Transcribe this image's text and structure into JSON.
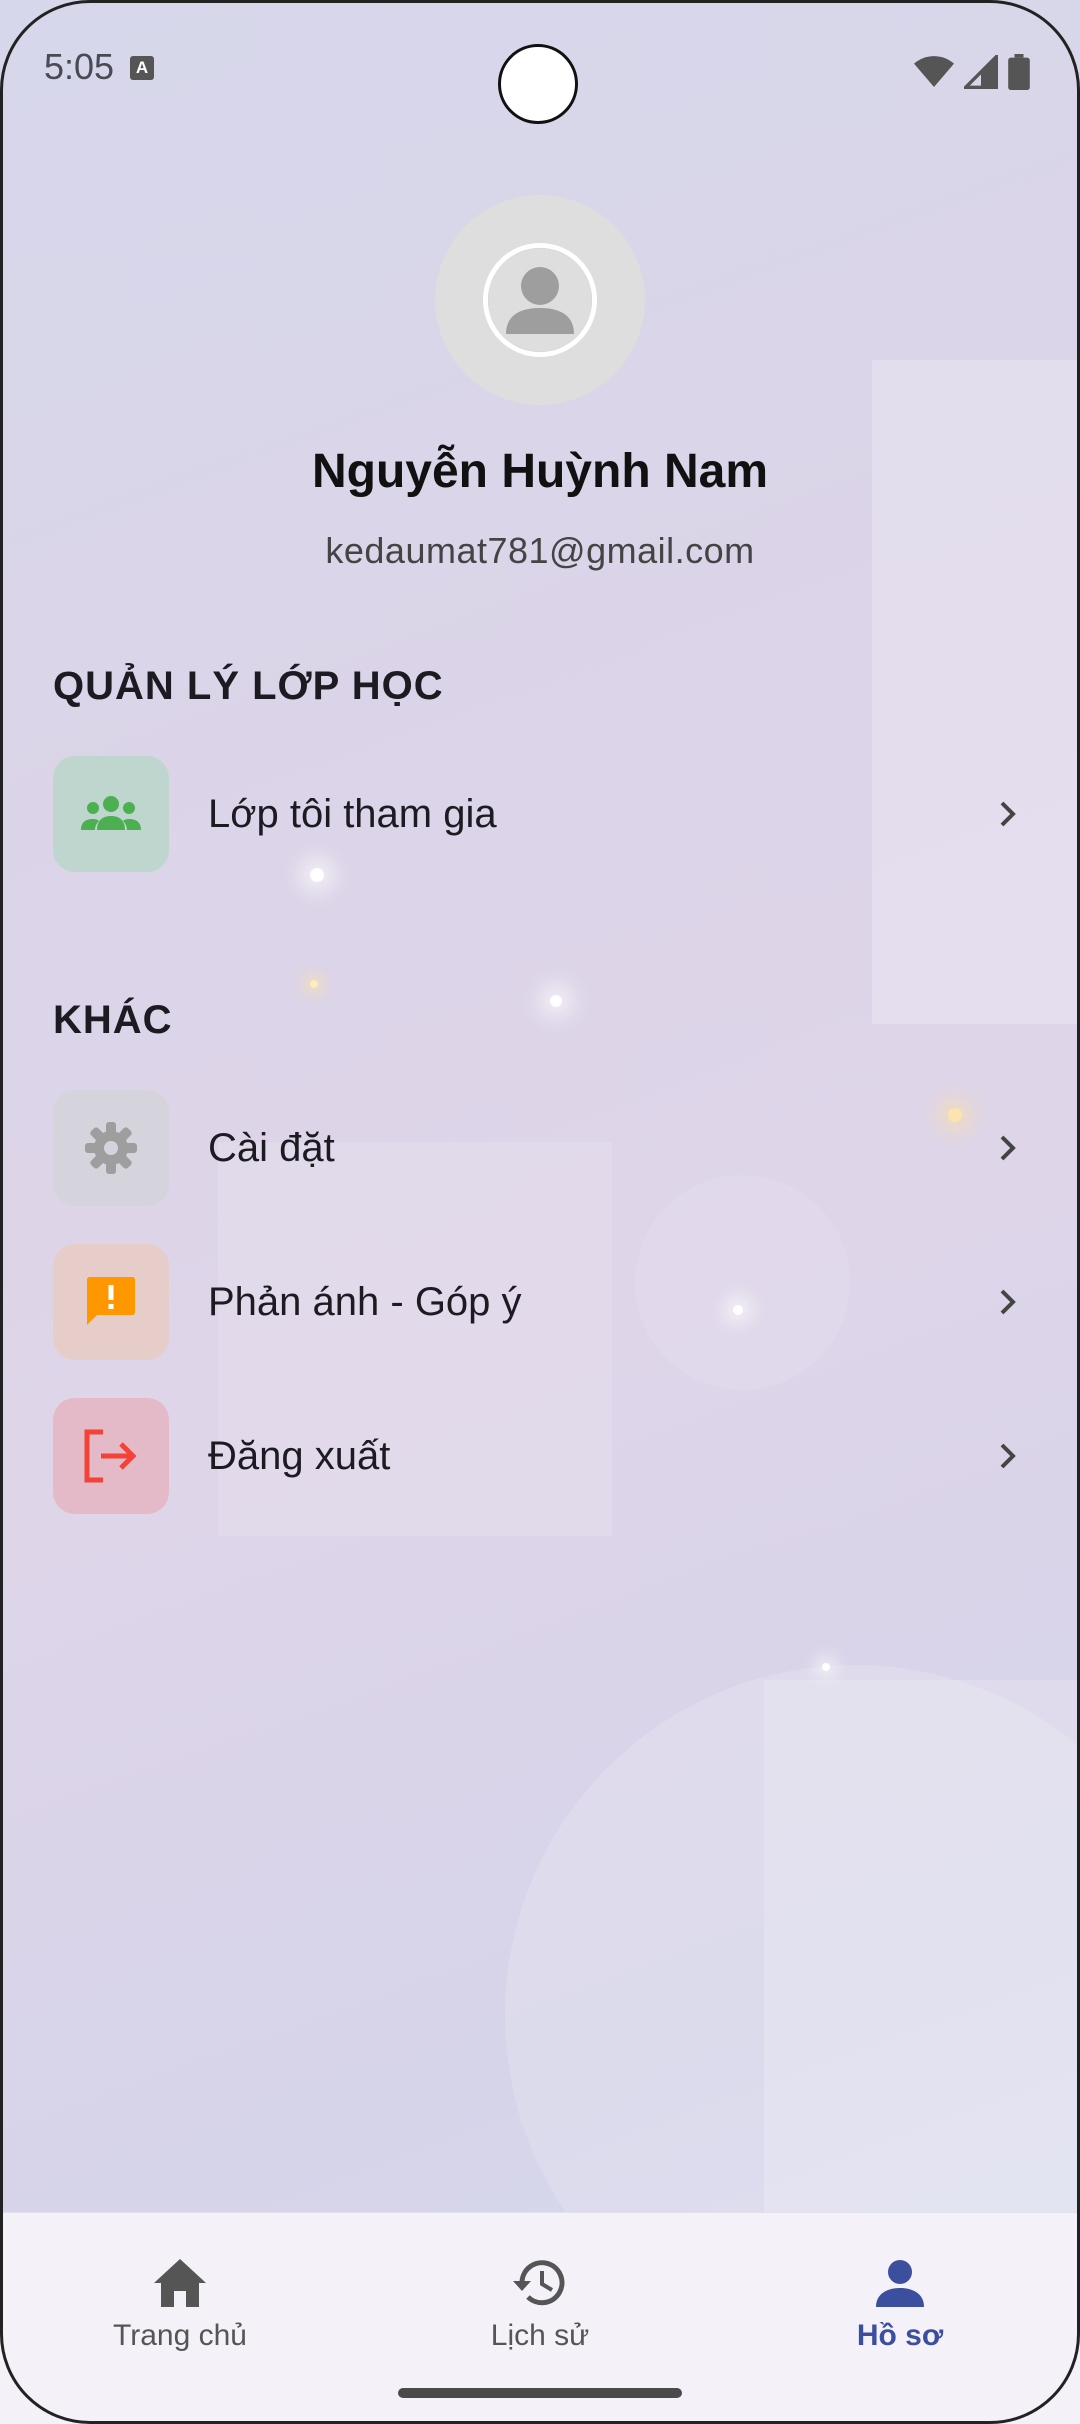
{
  "status_bar": {
    "time": "5:05",
    "notification_icon": "a-icon",
    "icons": [
      "wifi-icon",
      "cell-signal-icon",
      "battery-icon"
    ]
  },
  "profile": {
    "avatar_icon": "person-icon",
    "name": "Nguyễn Huỳnh Nam",
    "email": "kedaumat781@gmail.com"
  },
  "sections": [
    {
      "title": "QUẢN LÝ LỚP HỌC",
      "items": [
        {
          "label": "Lớp tôi tham gia",
          "icon": "group-icon",
          "icon_color": "#4caf50",
          "icon_bg": "#bfd6cf"
        }
      ]
    },
    {
      "title": "KHÁC",
      "items": [
        {
          "label": "Cài đặt",
          "icon": "gear-icon",
          "icon_color": "#9e9e9e",
          "icon_bg": "#d5d3dc"
        },
        {
          "label": "Phản ánh - Góp ý",
          "icon": "feedback-icon",
          "icon_color": "#ff9800",
          "icon_bg": "#e7cdc9"
        },
        {
          "label": "Đăng xuất",
          "icon": "logout-icon",
          "icon_color": "#f44336",
          "icon_bg": "#e4bac8"
        }
      ]
    }
  ],
  "bottom_nav": {
    "items": [
      {
        "label": "Trang chủ",
        "icon": "home-icon",
        "active": false
      },
      {
        "label": "Lịch sử",
        "icon": "history-icon",
        "active": false
      },
      {
        "label": "Hồ sơ",
        "icon": "person-icon",
        "active": true
      }
    ],
    "active_color": "#3c4f9e"
  }
}
